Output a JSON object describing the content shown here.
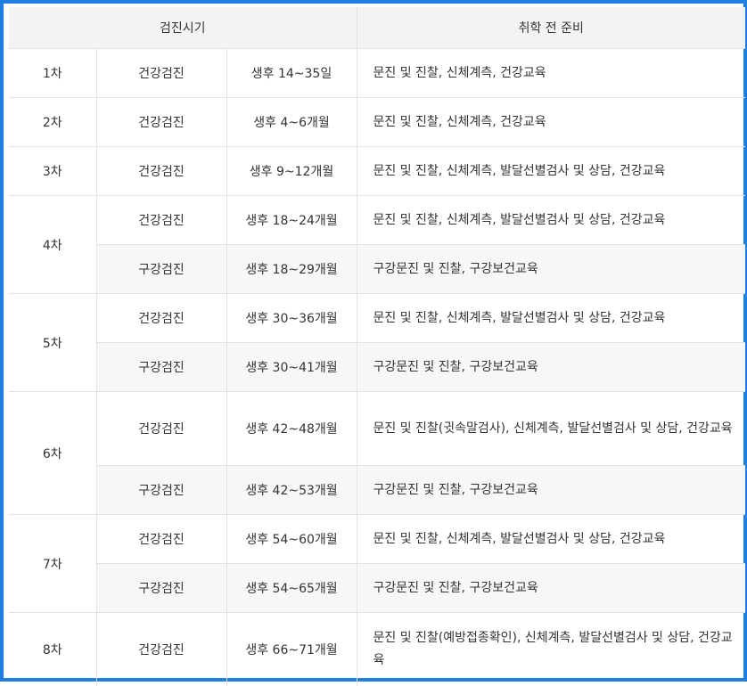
{
  "header": {
    "period": "검진시기",
    "prep": "취학 전 준비"
  },
  "rows": [
    {
      "stage": "1차",
      "type": "건강검진",
      "age": "생후 14~35일",
      "content": "문진 및 진찰, 신체계측, 건강교육"
    },
    {
      "stage": "2차",
      "type": "건강검진",
      "age": "생후 4~6개월",
      "content": "문진 및 진찰, 신체계측, 건강교육"
    },
    {
      "stage": "3차",
      "type": "건강검진",
      "age": "생후 9~12개월",
      "content": "문진 및 진찰, 신체계측, 발달선별검사 및 상담, 건강교육"
    },
    {
      "stage": "4차",
      "type": "건강검진",
      "age": "생후 18~24개월",
      "content": "문진 및 진찰, 신체계측, 발달선별검사 및 상담, 건강교육"
    },
    {
      "stage": "",
      "type": "구강검진",
      "age": "생후 18~29개월",
      "content": "구강문진 및 진찰, 구강보건교육"
    },
    {
      "stage": "5차",
      "type": "건강검진",
      "age": "생후 30~36개월",
      "content": "문진 및 진찰, 신체계측, 발달선별검사 및 상담, 건강교육"
    },
    {
      "stage": "",
      "type": "구강검진",
      "age": "생후 30~41개월",
      "content": "구강문진 및 진찰, 구강보건교육"
    },
    {
      "stage": "6차",
      "type": "건강검진",
      "age": "생후 42~48개월",
      "content": "문진 및 진찰(귓속말검사), 신체계측, 발달선별검사 및 상담, 건강교육"
    },
    {
      "stage": "",
      "type": "구강검진",
      "age": "생후 42~53개월",
      "content": "구강문진 및 진찰, 구강보건교육"
    },
    {
      "stage": "7차",
      "type": "건강검진",
      "age": "생후 54~60개월",
      "content": "문진 및 진찰, 신체계측, 발달선별검사 및 상담, 건강교육"
    },
    {
      "stage": "",
      "type": "구강검진",
      "age": "생후 54~65개월",
      "content": "구강문진 및 진찰, 구강보건교육"
    },
    {
      "stage": "8차",
      "type": "건강검진",
      "age": "생후 66~71개월",
      "content": "문진 및 진찰(예방접종확인), 신체계측, 발달선별검사 및 상담, 건강교육"
    }
  ]
}
